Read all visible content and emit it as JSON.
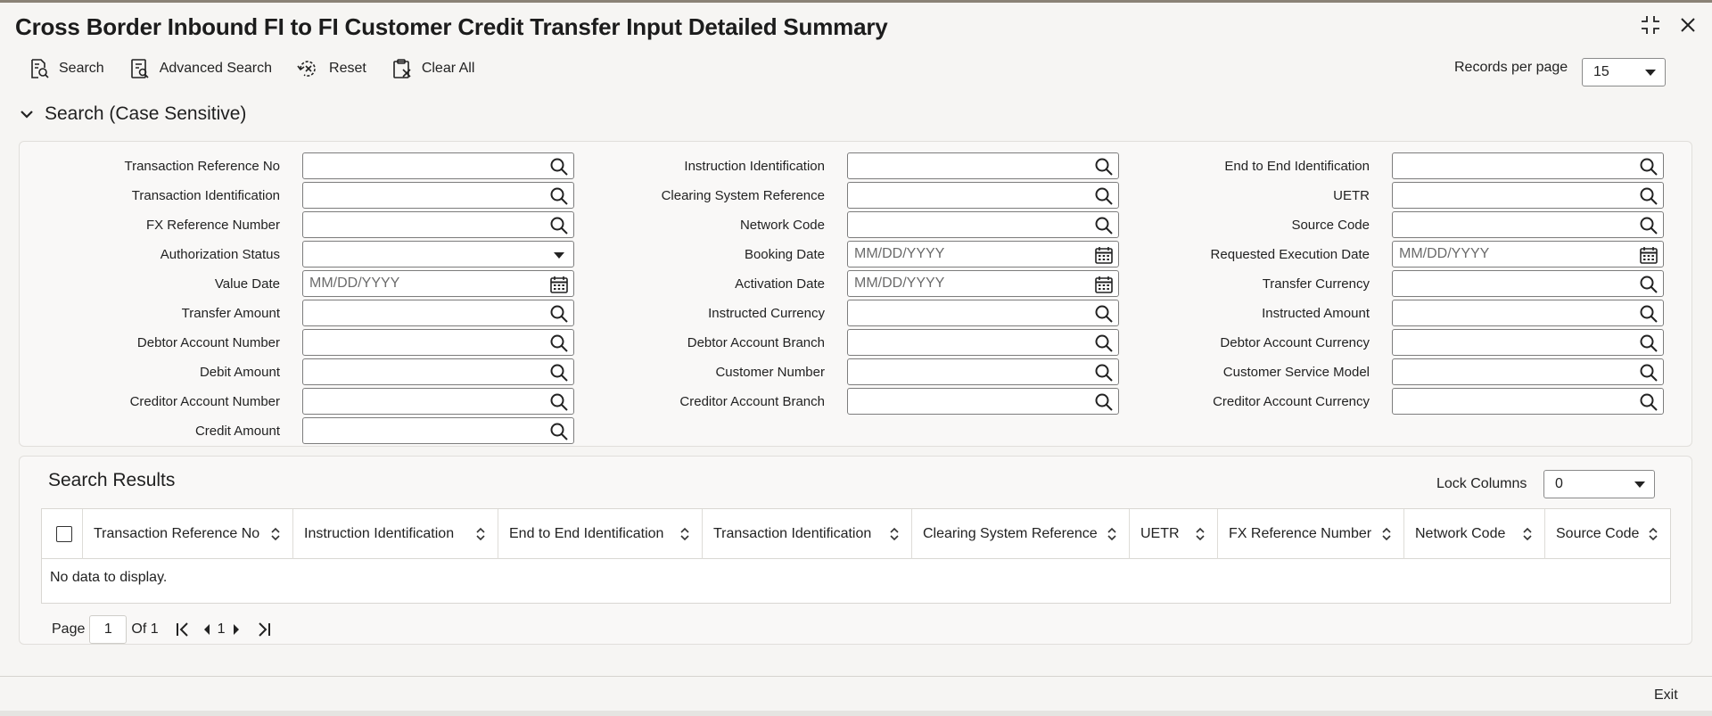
{
  "window": {
    "title": "Cross Border Inbound FI to FI Customer Credit Transfer Input Detailed Summary"
  },
  "toolbar": {
    "search": "Search",
    "advanced_search": "Advanced Search",
    "reset": "Reset",
    "clear_all": "Clear All"
  },
  "records_per_page": {
    "label": "Records per page",
    "value": "15"
  },
  "search_section": {
    "title": "Search (Case Sensitive)"
  },
  "fields": {
    "col1": [
      {
        "label": "Transaction Reference No",
        "type": "lookup",
        "value": ""
      },
      {
        "label": "Transaction Identification",
        "type": "lookup",
        "value": ""
      },
      {
        "label": "FX Reference Number",
        "type": "lookup",
        "value": ""
      },
      {
        "label": "Authorization Status",
        "type": "select",
        "value": ""
      },
      {
        "label": "Value Date",
        "type": "date",
        "placeholder": "MM/DD/YYYY"
      },
      {
        "label": "Transfer Amount",
        "type": "lookup",
        "value": ""
      },
      {
        "label": "Debtor Account Number",
        "type": "lookup",
        "value": ""
      },
      {
        "label": "Debit Amount",
        "type": "lookup",
        "value": ""
      },
      {
        "label": "Creditor Account Number",
        "type": "lookup",
        "value": ""
      },
      {
        "label": "Credit Amount",
        "type": "lookup",
        "value": ""
      }
    ],
    "col2": [
      {
        "label": "Instruction Identification",
        "type": "lookup",
        "value": ""
      },
      {
        "label": "Clearing System Reference",
        "type": "lookup",
        "value": ""
      },
      {
        "label": "Network Code",
        "type": "lookup",
        "value": ""
      },
      {
        "label": "Booking Date",
        "type": "date",
        "placeholder": "MM/DD/YYYY"
      },
      {
        "label": "Activation Date",
        "type": "date",
        "placeholder": "MM/DD/YYYY"
      },
      {
        "label": "Instructed Currency",
        "type": "lookup",
        "value": ""
      },
      {
        "label": "Debtor Account Branch",
        "type": "lookup",
        "value": ""
      },
      {
        "label": "Customer Number",
        "type": "lookup",
        "value": ""
      },
      {
        "label": "Creditor Account Branch",
        "type": "lookup",
        "value": ""
      }
    ],
    "col3": [
      {
        "label": "End to End Identification",
        "type": "lookup",
        "value": ""
      },
      {
        "label": "UETR",
        "type": "lookup",
        "value": ""
      },
      {
        "label": "Source Code",
        "type": "lookup",
        "value": ""
      },
      {
        "label": "Requested Execution Date",
        "type": "date",
        "placeholder": "MM/DD/YYYY"
      },
      {
        "label": "Transfer Currency",
        "type": "lookup",
        "value": ""
      },
      {
        "label": "Instructed Amount",
        "type": "lookup",
        "value": ""
      },
      {
        "label": "Debtor Account Currency",
        "type": "lookup",
        "value": ""
      },
      {
        "label": "Customer Service Model",
        "type": "lookup",
        "value": ""
      },
      {
        "label": "Creditor Account Currency",
        "type": "lookup",
        "value": ""
      }
    ]
  },
  "results": {
    "title": "Search Results",
    "lock_columns_label": "Lock Columns",
    "lock_columns_value": "0",
    "columns": [
      "Transaction Reference No",
      "Instruction Identification",
      "End to End Identification",
      "Transaction Identification",
      "Clearing System Reference",
      "UETR",
      "FX Reference Number",
      "Network Code",
      "Source Code"
    ],
    "empty_message": "No data to display."
  },
  "pager": {
    "page_label": "Page",
    "page_value": "1",
    "of_label": "Of 1",
    "current": "1"
  },
  "footer": {
    "exit": "Exit"
  },
  "icons": {
    "search": "magnifier-icon",
    "calendar": "calendar-icon",
    "expand": "expand-icon",
    "close": "close-icon"
  }
}
